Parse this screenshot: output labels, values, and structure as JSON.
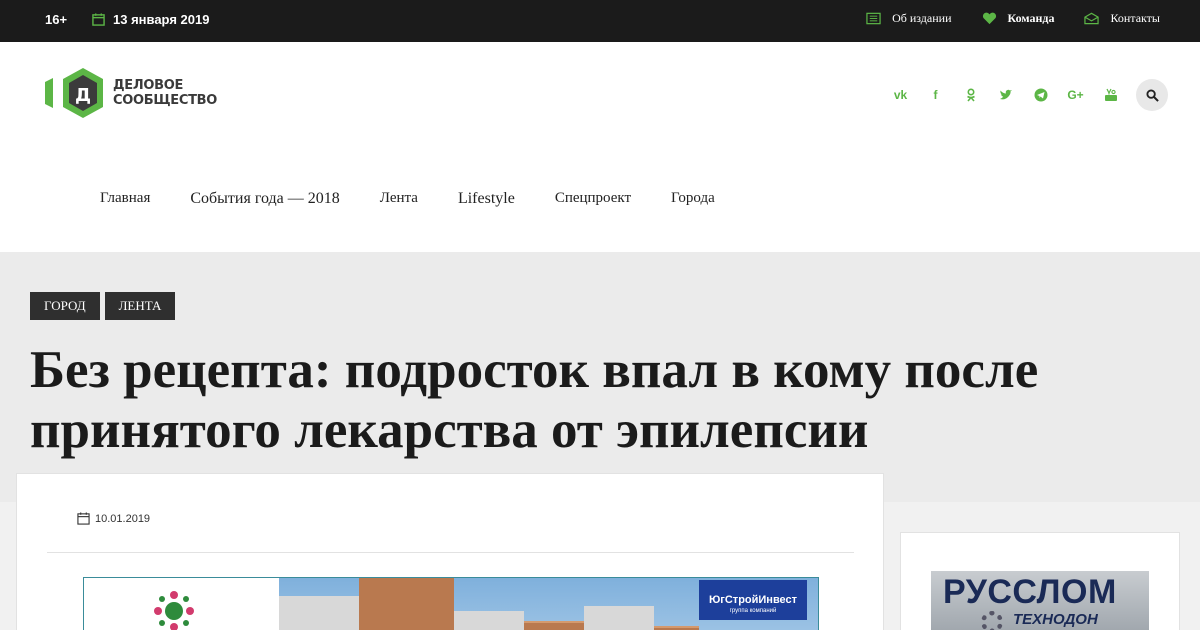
{
  "topbar": {
    "age_rating": "16+",
    "date": "13 января 2019",
    "links": [
      {
        "label": "Об издании",
        "icon": "newspaper-icon"
      },
      {
        "label": "Команда",
        "icon": "heart-icon"
      },
      {
        "label": "Контакты",
        "icon": "envelope-icon"
      }
    ]
  },
  "header": {
    "logo_line1": "ДЕЛОВОЕ",
    "logo_line2": "СООБЩЕСТВО",
    "logo_letter": "Д",
    "social": [
      {
        "label": "vk",
        "icon": "vk-icon"
      },
      {
        "label": "f",
        "icon": "facebook-icon"
      },
      {
        "label": "",
        "icon": "odnoklassniki-icon"
      },
      {
        "label": "",
        "icon": "twitter-icon"
      },
      {
        "label": "",
        "icon": "telegram-icon"
      },
      {
        "label": "G+",
        "icon": "google-plus-icon"
      },
      {
        "label": "",
        "icon": "youtube-icon"
      }
    ],
    "search_icon": "search-icon"
  },
  "nav": {
    "items": [
      "Главная",
      "События года — 2018",
      "Лента",
      "Lifestyle",
      "Спецпроект",
      "Города"
    ]
  },
  "article": {
    "tags": [
      "ГОРОД",
      "ЛЕНТА"
    ],
    "title": "Без рецепта: подросток впал в кому после принятого лекарства от эпилепсии",
    "date": "10.01.2019",
    "banner_sign": "ЮгСтройИнвест",
    "banner_sign_sub": "группа компаний"
  },
  "sidebar_ad": {
    "name": "РУССЛОМ",
    "sub": "ТЕХНОДОН"
  },
  "colors": {
    "accent": "#5cb646",
    "topbar": "#1b1b1b",
    "tag_bg": "#2f2f2f"
  }
}
